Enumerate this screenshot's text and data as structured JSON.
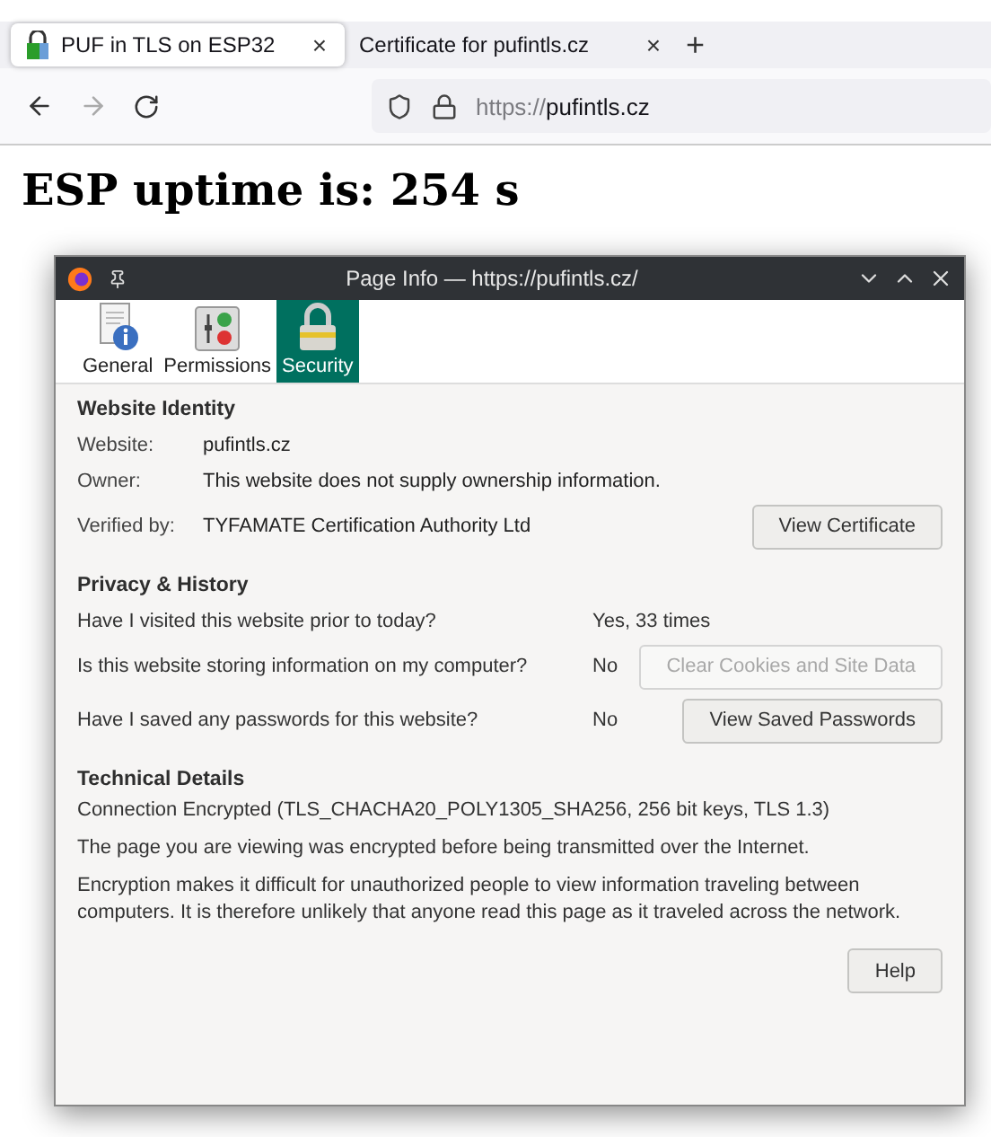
{
  "browser": {
    "tabs": [
      {
        "title": "PUF in TLS on ESP32",
        "selected": true,
        "close": "×",
        "has_favicon": true
      },
      {
        "title": "Certificate for pufintls.cz",
        "selected": false,
        "close": "×",
        "has_favicon": false
      }
    ],
    "new_tab": "+",
    "url": {
      "scheme": "https://",
      "host": "pufintls.cz"
    }
  },
  "page": {
    "heading": "ESP uptime is: 254 s"
  },
  "dialog": {
    "title": "Page Info — https://pufintls.cz/",
    "tabs": [
      {
        "label": "General",
        "kind": "general",
        "selected": false
      },
      {
        "label": "Permissions",
        "kind": "permissions",
        "selected": false
      },
      {
        "label": "Security",
        "kind": "security",
        "selected": true
      }
    ],
    "identity": {
      "heading": "Website Identity",
      "rows": [
        {
          "label": "Website:",
          "value": "pufintls.cz"
        },
        {
          "label": "Owner:",
          "value": "This website does not supply ownership information."
        },
        {
          "label": "Verified by:",
          "value": "TYFAMATE Certification Authority Ltd",
          "button": {
            "label": "View Certificate",
            "disabled": false
          }
        }
      ]
    },
    "privacy": {
      "heading": "Privacy & History",
      "rows": [
        {
          "question": "Have I visited this website prior to today?",
          "answer": "Yes, 33 times"
        },
        {
          "question": "Is this website storing information on my computer?",
          "answer": "No",
          "button": {
            "label": "Clear Cookies and Site Data",
            "disabled": true
          }
        },
        {
          "question": "Have I saved any passwords for this website?",
          "answer": "No",
          "button": {
            "label": "View Saved Passwords",
            "disabled": false
          }
        }
      ]
    },
    "technical": {
      "heading": "Technical Details",
      "lines": [
        "Connection Encrypted (TLS_CHACHA20_POLY1305_SHA256, 256 bit keys, TLS 1.3)",
        "The page you are viewing was encrypted before being transmitted over the Internet.",
        "Encryption makes it difficult for unauthorized people to view information traveling between computers. It is therefore unlikely that anyone read this page as it traveled across the network."
      ]
    },
    "help_button": "Help"
  }
}
